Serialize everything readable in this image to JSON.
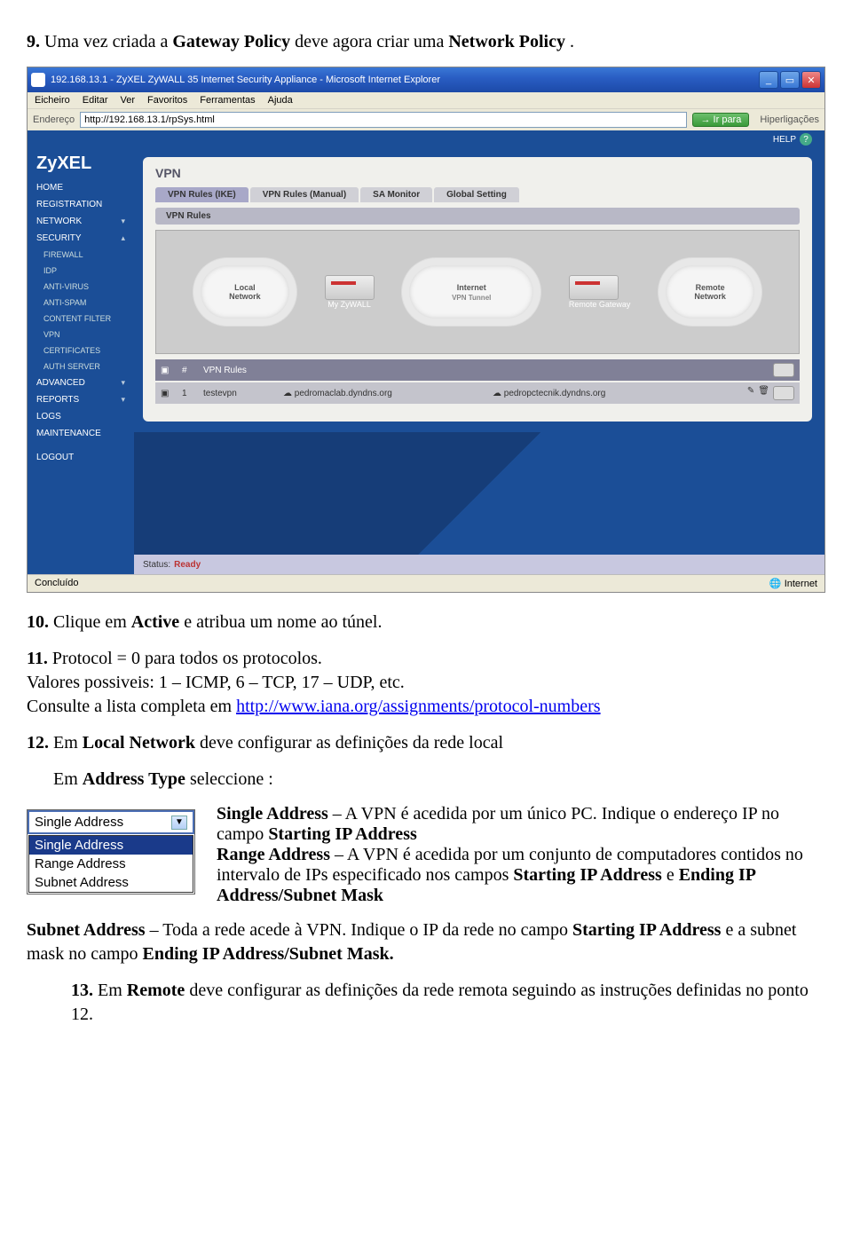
{
  "doc": {
    "h9a": "9.",
    "h9b": " Uma vez criada a ",
    "h9c": "Gateway Policy",
    "h9d": " deve agora criar uma ",
    "h9e": "Network Policy",
    "h9f": " .",
    "p10a": "10.",
    "p10b": " Clique em ",
    "p10c": "Active",
    "p10d": " e atribua um nome ao túnel.",
    "p11a": "11.",
    "p11b": " Protocol = 0 para todos os protocolos.",
    "p11c": "Valores possiveis: 1 – ICMP, 6 – TCP, 17 – UDP, etc.",
    "p11d": "Consulte a lista completa em ",
    "p11link": "http://www.iana.org/assignments/protocol-numbers",
    "p12a": "12.",
    "p12b": " Em ",
    "p12c": "Local Network",
    "p12d": " deve configurar as definições da rede local",
    "p12e": "Em ",
    "p12f": "Address Type",
    "p12g": " seleccione :",
    "sa1": "Single Address",
    "sa2": " – A VPN é acedida por um único PC. Indique o endereço IP no campo ",
    "sa3": "Starting IP Address",
    "ra1": "Range Address",
    "ra2": " – A VPN é acedida por um conjunto de computadores contidos no intervalo de IPs especificado nos campos ",
    "ra3": "Starting IP Address",
    "ra4": " e ",
    "ra5": "Ending IP Address/Subnet Mask",
    "sub1": "Subnet Address",
    "sub2": " – Toda a rede acede à VPN. Indique o IP da rede no campo ",
    "sub3": "Starting IP Address",
    "sub4": " e a subnet mask no campo ",
    "sub5": "Ending IP Address/Subnet Mask.",
    "p13a": "13.",
    "p13b": " Em ",
    "p13c": "Remote",
    "p13d": " deve configurar as definições da rede remota seguindo as instruções definidas no ponto 12."
  },
  "ie": {
    "title": "192.168.13.1 - ZyXEL ZyWALL 35 Internet Security Appliance - Microsoft Internet Explorer",
    "menus": [
      "Eicheiro",
      "Editar",
      "Ver",
      "Favoritos",
      "Ferramentas",
      "Ajuda"
    ],
    "addr_label": "Endereço",
    "url": "http://192.168.13.1/rpSys.html",
    "go": "Ir para",
    "links": "Hiperligações",
    "status_done": "Concluído",
    "status_zone": "Internet"
  },
  "app": {
    "logo": "ZyXEL",
    "help": "HELP",
    "sidebar": [
      {
        "label": "HOME"
      },
      {
        "label": "REGISTRATION"
      },
      {
        "label": "NETWORK",
        "chev": true
      },
      {
        "label": "SECURITY",
        "chev": true
      },
      {
        "label": "FIREWALL",
        "sub": true
      },
      {
        "label": "IDP",
        "sub": true
      },
      {
        "label": "ANTI-VIRUS",
        "sub": true
      },
      {
        "label": "ANTI-SPAM",
        "sub": true
      },
      {
        "label": "CONTENT FILTER",
        "sub": true
      },
      {
        "label": "VPN",
        "sub": true
      },
      {
        "label": "CERTIFICATES",
        "sub": true
      },
      {
        "label": "AUTH SERVER",
        "sub": true
      },
      {
        "label": "ADVANCED",
        "chev": true
      },
      {
        "label": "REPORTS",
        "chev": true
      },
      {
        "label": "LOGS"
      },
      {
        "label": "MAINTENANCE"
      },
      {
        "label": ""
      },
      {
        "label": "LOGOUT"
      }
    ],
    "page_title": "VPN",
    "tabs": [
      "VPN Rules (IKE)",
      "VPN Rules (Manual)",
      "SA Monitor",
      "Global Setting"
    ],
    "subhead": "VPN Rules",
    "cloud_local": "Local\nNetwork",
    "cloud_internet": "Internet",
    "cloud_tunnel": "VPN Tunnel",
    "cloud_remote": "Remote\nNetwork",
    "gw_my": "My ZyWALL",
    "gw_remote": "Remote Gateway",
    "grid_header_col": "VPN Rules",
    "grid_num": "#",
    "row": {
      "num": "1",
      "name": "testevpn",
      "gw1": "pedromaclab.dyndns.org",
      "gw2": "pedropctecnik.dyndns.org"
    },
    "status_lbl": "Status:",
    "status_val": "Ready"
  },
  "dropdown": {
    "selected": "Single Address",
    "options": [
      "Single Address",
      "Range Address",
      "Subnet Address"
    ]
  }
}
